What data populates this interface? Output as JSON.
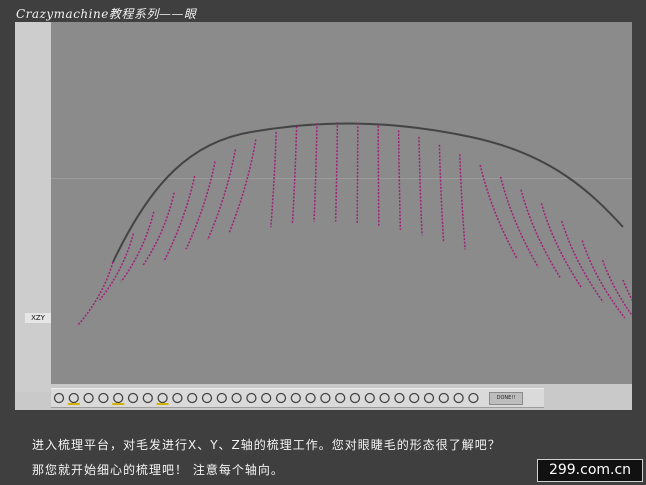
{
  "header": {
    "title": "Crazymachine教程系列——眼"
  },
  "viewport": {
    "axis_label": "XZY",
    "background": "#8b8b8b",
    "curve_color": "#444444",
    "strand_color": "#a0207a"
  },
  "toolbar": {
    "done_label": "DONE!!",
    "tools": [
      "comb-tool-1-icon",
      "comb-tool-2-icon",
      "comb-tool-3-icon",
      "comb-tool-4-icon",
      "brush-icon",
      "pointer-icon",
      "rect-select-icon",
      "cut-icon",
      "pen-icon",
      "length-icon",
      "scale-icon",
      "rotate-icon",
      "twist-icon",
      "gear-icon",
      "wave-icon",
      "frizz-icon",
      "clump-icon",
      "kink-icon",
      "flip-icon",
      "zoom-icon",
      "sphere-icon",
      "circle-icon",
      "gear-icon-2",
      "lasso-icon",
      "lock-icon",
      "unlock-icon",
      "list-icon",
      "pin-icon",
      "undo-icon"
    ]
  },
  "caption": {
    "line1": "进入梳理平台，对毛发进行X、Y、Z轴的梳理工作。您对眼睫毛的形态很了解吧？",
    "line2": "那您就开始细心的梳理吧！ 注意每个轴向。"
  },
  "watermark": {
    "text": "299.com.cn"
  }
}
